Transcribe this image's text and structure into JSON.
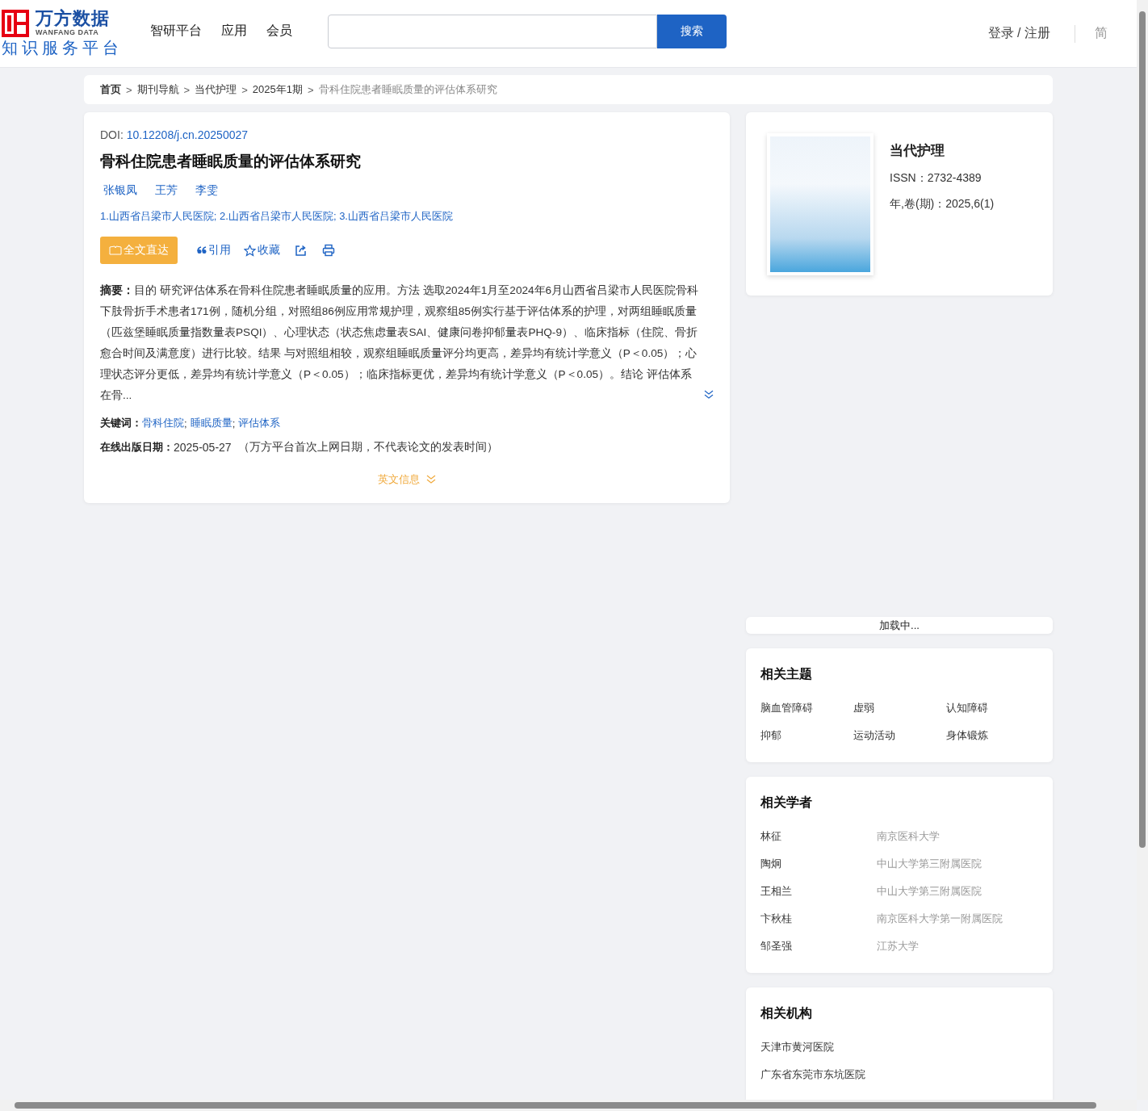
{
  "header": {
    "logo": {
      "brand": "万方数据",
      "brand_en": "WANFANG DATA",
      "tagline": "知识服务平台"
    },
    "nav": [
      "智研平台",
      "应用",
      "会员"
    ],
    "search": {
      "button": "搜索"
    },
    "login": "登录 / 注册",
    "language": "简"
  },
  "breadcrumb": {
    "separator": ">",
    "items": [
      {
        "label": "首页",
        "current": false
      },
      {
        "label": "期刊导航",
        "current": false
      },
      {
        "label": "当代护理",
        "current": false
      },
      {
        "label": "2025年1期",
        "current": false
      },
      {
        "label": "骨科住院患者睡眠质量的评估体系研究",
        "current": true
      }
    ]
  },
  "article": {
    "doi_label": "DOI:",
    "doi": "10.12208/j.cn.20250027",
    "title": "骨科住院患者睡眠质量的评估体系研究",
    "authors": [
      "张银凤",
      "王芳",
      "李雯"
    ],
    "affiliations": "1.山西省吕梁市人民医院; 2.山西省吕梁市人民医院; 3.山西省吕梁市人民医院",
    "actions": [
      {
        "kind": "fulltext",
        "label": "全文直达"
      },
      {
        "kind": "cite",
        "label": "引用"
      },
      {
        "kind": "favorite",
        "label": "收藏"
      },
      {
        "kind": "share"
      },
      {
        "kind": "print"
      }
    ],
    "abstract": "**摘要：**目的 研究评估体系在骨科住院患者睡眠质量的应用。方法 选取2024年1月至2024年6月山西省吕梁市人民医院骨科下肢骨折手术患者171例，随机分组，对照组86例应用常规护理，观察组85例实行基于评估体系的护理，对两组睡眠质量（匹兹堡睡眠质量指数量表PSQI）、心理状态（状态焦虑量表SAI、健康问卷抑郁量表PHQ-9）、临床指标（住院、骨折愈合时间及满意度）进行比较。结果 与对照组相较，观察组睡眠质量评分均更高，差异均有统计学意义（P＜0.05）；心理状态评分更低，差异均有统计学意义（P＜0.05）；临床指标更优，差异均有统计学意义（P＜0.05）。结论 评估体系在骨...",
    "keywords_label": "关键词：",
    "keyword_separator": ";",
    "keywords": [
      "骨科住院",
      "睡眠质量",
      "评估体系"
    ],
    "date_label": "在线出版日期：",
    "date": "2025-05-27",
    "date_note": "（万方平台首次上网日期，不代表论文的发表时间）",
    "english_toggle": "英文信息"
  },
  "journal": {
    "name": "当代护理",
    "fields": [
      {
        "label": "ISSN：",
        "value": "2732-4389"
      },
      {
        "label": "年,卷(期)：",
        "value": "2025,6(1)"
      }
    ]
  },
  "loading": "加载中...",
  "related_topics": {
    "title": "相关主题",
    "items": [
      "脑血管障碍",
      "虚弱",
      "认知障碍",
      "抑郁",
      "运动活动",
      "身体锻炼"
    ]
  },
  "related_scholars": {
    "title": "相关学者",
    "items": [
      {
        "name": "林征",
        "org": "南京医科大学"
      },
      {
        "name": "陶炯",
        "org": "中山大学第三附属医院"
      },
      {
        "name": "王相兰",
        "org": "中山大学第三附属医院"
      },
      {
        "name": "卞秋桂",
        "org": "南京医科大学第一附属医院"
      },
      {
        "name": "邹圣强",
        "org": "江苏大学"
      }
    ]
  },
  "related_institutions": {
    "title": "相关机构",
    "items": [
      "天津市黄河医院",
      "广东省东莞市东坑医院"
    ]
  }
}
